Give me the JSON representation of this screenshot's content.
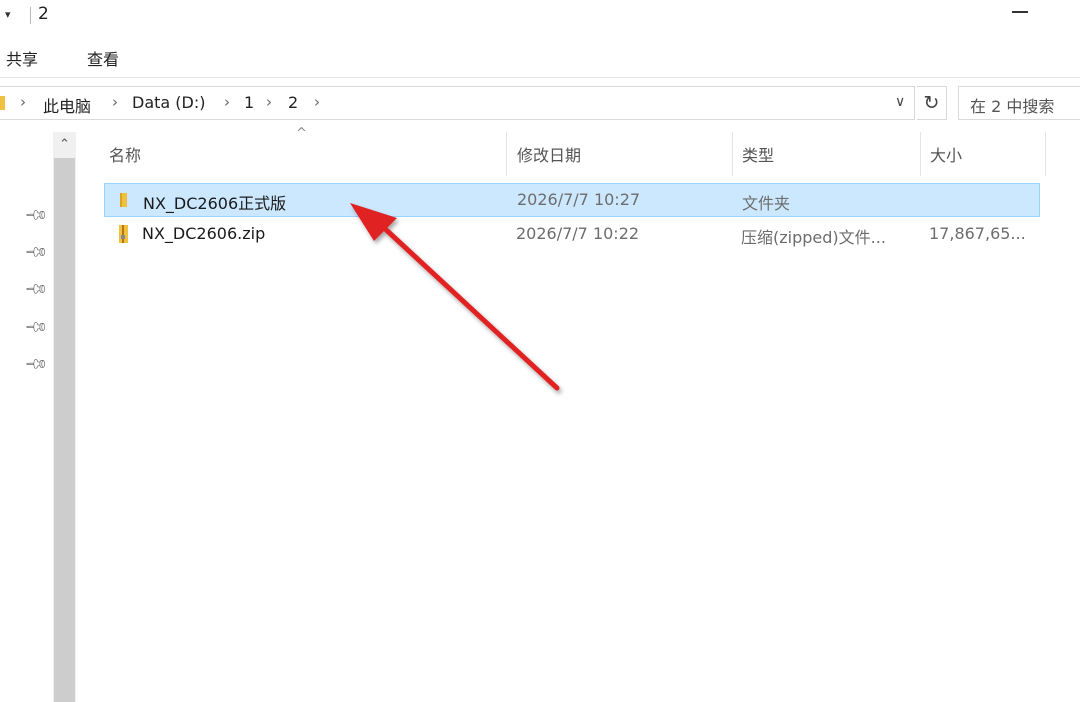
{
  "window": {
    "title": "2",
    "qa_arrow": "▾",
    "minimize_icon": "minimize-icon"
  },
  "ribbon": {
    "tabs": [
      "共享",
      "查看"
    ]
  },
  "address_bar": {
    "crumbs": [
      "此电脑",
      "Data (D:)",
      "1",
      "2"
    ],
    "dropdown_glyph": "∨",
    "refresh_glyph": "↻"
  },
  "search": {
    "placeholder": "在 2 中搜索"
  },
  "columns": {
    "name": "名称",
    "date": "修改日期",
    "type": "类型",
    "size": "大小"
  },
  "files": [
    {
      "name": "NX_DC2606正式版",
      "date": "2026/7/7 10:27",
      "type": "文件夹",
      "size": "",
      "icon": "folder-icon",
      "selected": true
    },
    {
      "name": "NX_DC2606.zip",
      "date": "2026/7/7 10:22",
      "type": "压缩(zipped)文件...",
      "size": "17,867,65...",
      "icon": "zip-folder-icon",
      "selected": false
    }
  ],
  "colors": {
    "selection_bg": "#cce8ff",
    "selection_border": "#99d1ff",
    "folder": "#f0c040",
    "annotation_arrow": "#e02020"
  }
}
